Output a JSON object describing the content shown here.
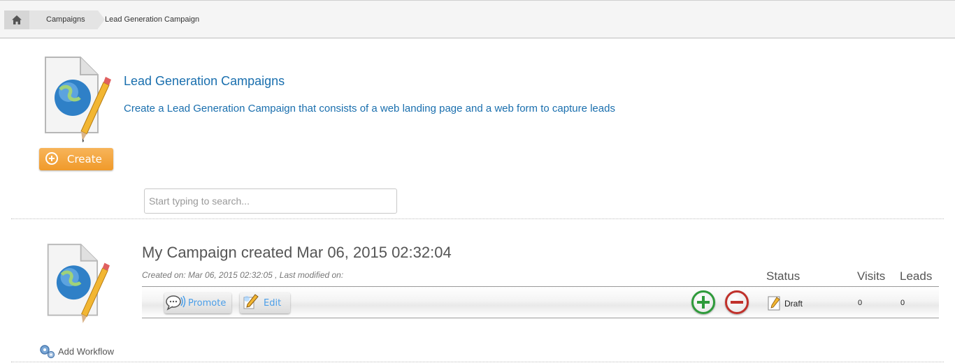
{
  "breadcrumb": {
    "home_icon": "home-icon",
    "items": [
      "Campaigns",
      "Lead Generation Campaign"
    ]
  },
  "hero": {
    "title": "Lead Generation Campaigns",
    "description": "Create a Lead Generation Campaign that consists of a web landing page and a web form to capture leads",
    "create_label": "Create",
    "icon": "web-page-pencil-icon"
  },
  "search": {
    "placeholder": "Start typing to search...",
    "value": ""
  },
  "columns": {
    "status": "Status",
    "visits": "Visits",
    "leads": "Leads"
  },
  "campaigns": [
    {
      "title": "My Campaign created Mar 06, 2015 02:32:04",
      "meta": "Created on: Mar 06, 2015 02:32:05 , Last modified on:",
      "promote_label": "Promote",
      "edit_label": "Edit",
      "status": "Draft",
      "visits": "0",
      "leads": "0",
      "add_workflow_label": "Add Workflow"
    }
  ],
  "colors": {
    "accent": "#1a6fae",
    "create": "#f0a030",
    "button_text": "#4b9ee8",
    "add_green": "#2e9a3a",
    "remove_red": "#c0302a"
  }
}
